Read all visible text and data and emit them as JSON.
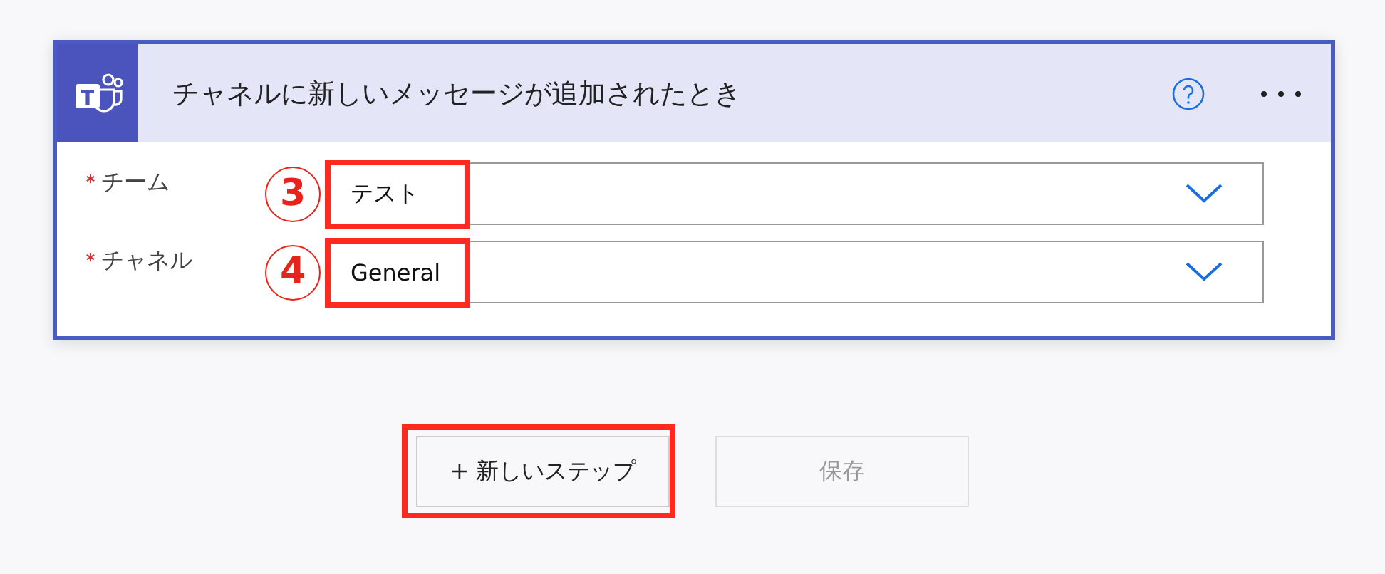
{
  "card": {
    "title": "チャネルに新しいメッセージが追加されたとき",
    "fields": [
      {
        "label": "チーム",
        "required": true,
        "marker": "3",
        "value": "テスト",
        "highlighted": true
      },
      {
        "label": "チャネル",
        "required": true,
        "marker": "4",
        "value": "General",
        "highlighted": true
      }
    ]
  },
  "buttons": [
    {
      "label": "+ 新しいステップ",
      "disabled": false,
      "highlighted": true
    },
    {
      "label": "保存",
      "disabled": true,
      "highlighted": false
    }
  ]
}
